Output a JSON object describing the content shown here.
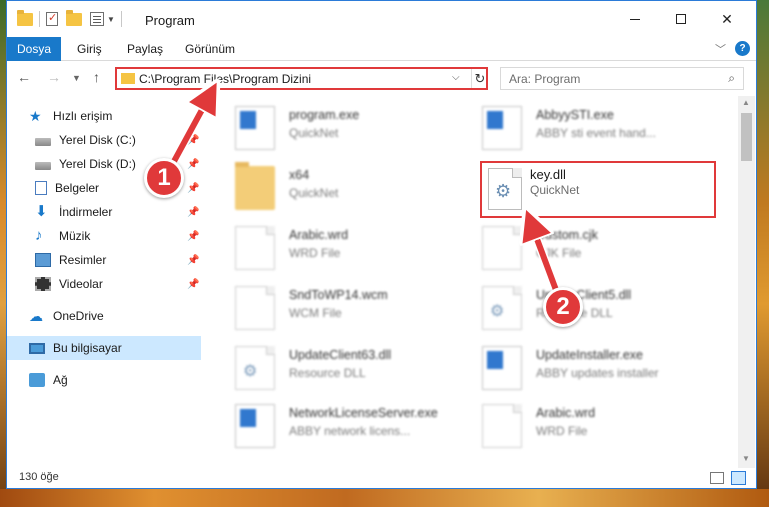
{
  "window": {
    "title": "Program",
    "controls": {
      "minimize": "—",
      "maximize": "☐",
      "close": "✕"
    }
  },
  "ribbon": {
    "file_tab": "Dosya",
    "tabs": [
      "Giriş",
      "Paylaş",
      "Görünüm"
    ],
    "help": "?"
  },
  "navbar": {
    "address": "C:\\Program Files\\Program Dizini",
    "search_placeholder": "Ara: Program"
  },
  "sidebar": {
    "items": [
      {
        "label": "Hızlı erişim",
        "icon": "star-icon"
      },
      {
        "label": "Yerel Disk (C:)",
        "icon": "disk-icon"
      },
      {
        "label": "Yerel Disk (D:)",
        "icon": "disk-icon"
      },
      {
        "label": "Belgeler",
        "icon": "documents-icon"
      },
      {
        "label": "İndirmeler",
        "icon": "download-icon"
      },
      {
        "label": "Müzik",
        "icon": "music-icon"
      },
      {
        "label": "Resimler",
        "icon": "pictures-icon"
      },
      {
        "label": "Videolar",
        "icon": "videos-icon"
      },
      {
        "label": "OneDrive",
        "icon": "cloud-icon"
      },
      {
        "label": "Bu bilgisayar",
        "icon": "computer-icon"
      },
      {
        "label": "Ağ",
        "icon": "network-icon"
      }
    ]
  },
  "files": [
    {
      "name": "program.exe",
      "type": "QuickNet"
    },
    {
      "name": "AbbyySTI.exe",
      "type": "ABBY sti event hand..."
    },
    {
      "name": "x64",
      "type": "QuickNet"
    },
    {
      "name": "key.dll",
      "type": "QuickNet"
    },
    {
      "name": "Arabic.wrd",
      "type": "WRD File"
    },
    {
      "name": "Custom.cjk",
      "type": "CJK File"
    },
    {
      "name": "SndToWP14.wcm",
      "type": "WCM File"
    },
    {
      "name": "UpdateClient5.dll",
      "type": "Resource DLL"
    },
    {
      "name": "UpdateClient63.dll",
      "type": "Resource DLL"
    },
    {
      "name": "UpdateInstaller.exe",
      "type": "ABBY updates installer"
    },
    {
      "name": "NetworkLicenseServer.exe",
      "type": "ABBY network licens..."
    },
    {
      "name": "Arabic.wrd",
      "type": "WRD File"
    }
  ],
  "status": {
    "count": "130 öğe"
  },
  "markers": {
    "one": "1",
    "two": "2"
  },
  "colors": {
    "accent": "#1979ca",
    "highlight": "#e0393a"
  }
}
